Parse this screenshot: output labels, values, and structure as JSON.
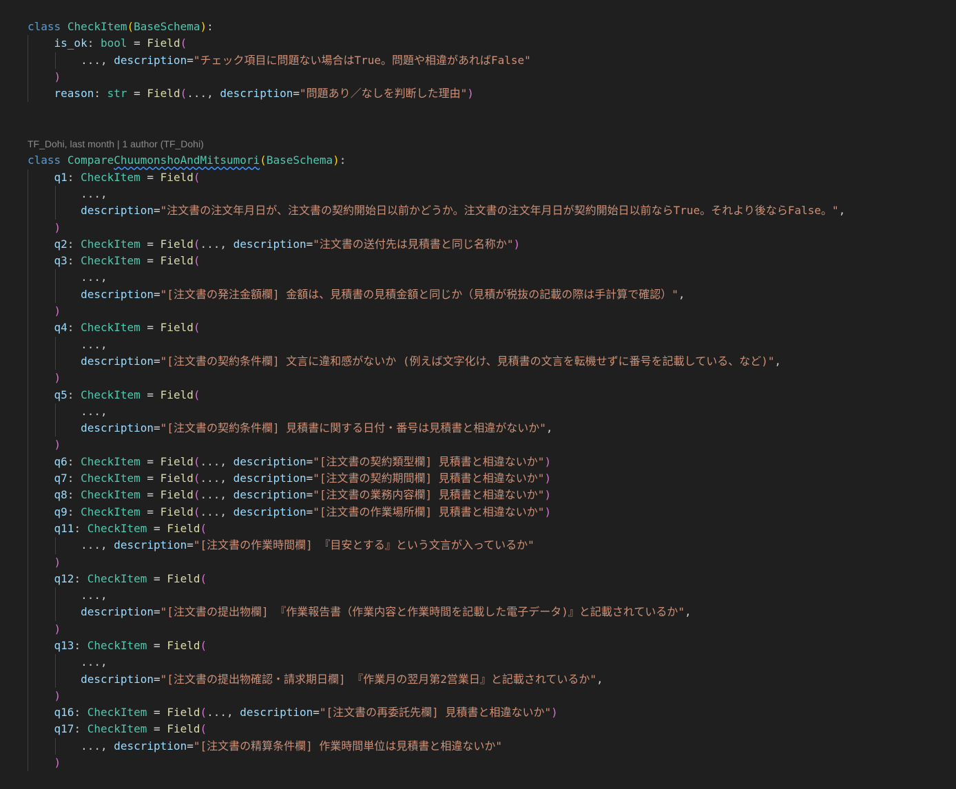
{
  "editor": {
    "blame_annotation": "TF_Dohi, last month | 1 author (TF_Dohi)",
    "lines": [
      {
        "indent": 0,
        "tokens": [
          [
            "kw",
            "class"
          ],
          [
            "t",
            " "
          ],
          [
            "cls",
            "CheckItem"
          ],
          [
            "p1",
            "("
          ],
          [
            "cls",
            "BaseSchema"
          ],
          [
            "p1",
            ")"
          ],
          [
            "t",
            ":"
          ]
        ]
      },
      {
        "indent": 1,
        "tokens": [
          [
            "var",
            "is_ok"
          ],
          [
            "t",
            ": "
          ],
          [
            "cls",
            "bool"
          ],
          [
            "op",
            " = "
          ],
          [
            "fn",
            "Field"
          ],
          [
            "p2",
            "("
          ]
        ]
      },
      {
        "indent": 2,
        "tokens": [
          [
            "t",
            "..., "
          ],
          [
            "var",
            "description"
          ],
          [
            "op",
            "="
          ],
          [
            "str",
            "\"チェック項目に問題ない場合はTrue。問題や相違があればFalse\""
          ]
        ]
      },
      {
        "indent": 1,
        "tokens": [
          [
            "p2",
            ")"
          ]
        ]
      },
      {
        "indent": 1,
        "tokens": [
          [
            "var",
            "reason"
          ],
          [
            "t",
            ": "
          ],
          [
            "cls",
            "str"
          ],
          [
            "op",
            " = "
          ],
          [
            "fn",
            "Field"
          ],
          [
            "p2",
            "("
          ],
          [
            "t",
            "..., "
          ],
          [
            "var",
            "description"
          ],
          [
            "op",
            "="
          ],
          [
            "str",
            "\"問題あり／なしを判断した理由\""
          ],
          [
            "p2",
            ")"
          ]
        ]
      },
      {
        "indent": 0,
        "tokens": []
      },
      {
        "indent": 0,
        "tokens": []
      },
      {
        "indent": 0,
        "blame": true,
        "tokens": []
      },
      {
        "indent": 0,
        "tokens": [
          [
            "kw",
            "class"
          ],
          [
            "t",
            " "
          ],
          [
            "cls",
            "Compare"
          ],
          [
            "clsq",
            "ChuumonshoAndMitsumori"
          ],
          [
            "p1",
            "("
          ],
          [
            "cls",
            "BaseSchema"
          ],
          [
            "p1",
            ")"
          ],
          [
            "t",
            ":"
          ]
        ]
      },
      {
        "indent": 1,
        "tokens": [
          [
            "var",
            "q1"
          ],
          [
            "t",
            ": "
          ],
          [
            "cls",
            "CheckItem"
          ],
          [
            "op",
            " = "
          ],
          [
            "fn",
            "Field"
          ],
          [
            "p2",
            "("
          ]
        ]
      },
      {
        "indent": 2,
        "tokens": [
          [
            "t",
            "...,"
          ]
        ]
      },
      {
        "indent": 2,
        "tokens": [
          [
            "var",
            "description"
          ],
          [
            "op",
            "="
          ],
          [
            "str",
            "\"注文書の注文年月日が、注文書の契約開始日以前かどうか。注文書の注文年月日が契約開始日以前ならTrue。それより後ならFalse。\""
          ],
          [
            "t",
            ","
          ]
        ]
      },
      {
        "indent": 1,
        "tokens": [
          [
            "p2",
            ")"
          ]
        ]
      },
      {
        "indent": 1,
        "tokens": [
          [
            "var",
            "q2"
          ],
          [
            "t",
            ": "
          ],
          [
            "cls",
            "CheckItem"
          ],
          [
            "op",
            " = "
          ],
          [
            "fn",
            "Field"
          ],
          [
            "p2",
            "("
          ],
          [
            "t",
            "..., "
          ],
          [
            "var",
            "description"
          ],
          [
            "op",
            "="
          ],
          [
            "str",
            "\"注文書の送付先は見積書と同じ名称か\""
          ],
          [
            "p2",
            ")"
          ]
        ]
      },
      {
        "indent": 1,
        "tokens": [
          [
            "var",
            "q3"
          ],
          [
            "t",
            ": "
          ],
          [
            "cls",
            "CheckItem"
          ],
          [
            "op",
            " = "
          ],
          [
            "fn",
            "Field"
          ],
          [
            "p2",
            "("
          ]
        ]
      },
      {
        "indent": 2,
        "tokens": [
          [
            "t",
            "...,"
          ]
        ]
      },
      {
        "indent": 2,
        "tokens": [
          [
            "var",
            "description"
          ],
          [
            "op",
            "="
          ],
          [
            "str",
            "\"[注文書の発注金額欄] 金額は、見積書の見積金額と同じか（見積が税抜の記載の際は手計算で確認）\""
          ],
          [
            "t",
            ","
          ]
        ]
      },
      {
        "indent": 1,
        "tokens": [
          [
            "p2",
            ")"
          ]
        ]
      },
      {
        "indent": 1,
        "tokens": [
          [
            "var",
            "q4"
          ],
          [
            "t",
            ": "
          ],
          [
            "cls",
            "CheckItem"
          ],
          [
            "op",
            " = "
          ],
          [
            "fn",
            "Field"
          ],
          [
            "p2",
            "("
          ]
        ]
      },
      {
        "indent": 2,
        "tokens": [
          [
            "t",
            "...,"
          ]
        ]
      },
      {
        "indent": 2,
        "tokens": [
          [
            "var",
            "description"
          ],
          [
            "op",
            "="
          ],
          [
            "str",
            "\"[注文書の契約条件欄] 文言に違和感がないか (例えば文字化け、見積書の文言を転機せずに番号を記載している、など)\""
          ],
          [
            "t",
            ","
          ]
        ]
      },
      {
        "indent": 1,
        "tokens": [
          [
            "p2",
            ")"
          ]
        ]
      },
      {
        "indent": 1,
        "tokens": [
          [
            "var",
            "q5"
          ],
          [
            "t",
            ": "
          ],
          [
            "cls",
            "CheckItem"
          ],
          [
            "op",
            " = "
          ],
          [
            "fn",
            "Field"
          ],
          [
            "p2",
            "("
          ]
        ]
      },
      {
        "indent": 2,
        "tokens": [
          [
            "t",
            "...,"
          ]
        ]
      },
      {
        "indent": 2,
        "tokens": [
          [
            "var",
            "description"
          ],
          [
            "op",
            "="
          ],
          [
            "str",
            "\"[注文書の契約条件欄] 見積書に関する日付・番号は見積書と相違がないか\""
          ],
          [
            "t",
            ","
          ]
        ]
      },
      {
        "indent": 1,
        "tokens": [
          [
            "p2",
            ")"
          ]
        ]
      },
      {
        "indent": 1,
        "tokens": [
          [
            "var",
            "q6"
          ],
          [
            "t",
            ": "
          ],
          [
            "cls",
            "CheckItem"
          ],
          [
            "op",
            " = "
          ],
          [
            "fn",
            "Field"
          ],
          [
            "p2",
            "("
          ],
          [
            "t",
            "..., "
          ],
          [
            "var",
            "description"
          ],
          [
            "op",
            "="
          ],
          [
            "str",
            "\"[注文書の契約類型欄] 見積書と相違ないか\""
          ],
          [
            "p2",
            ")"
          ]
        ]
      },
      {
        "indent": 1,
        "tokens": [
          [
            "var",
            "q7"
          ],
          [
            "t",
            ": "
          ],
          [
            "cls",
            "CheckItem"
          ],
          [
            "op",
            " = "
          ],
          [
            "fn",
            "Field"
          ],
          [
            "p2",
            "("
          ],
          [
            "t",
            "..., "
          ],
          [
            "var",
            "description"
          ],
          [
            "op",
            "="
          ],
          [
            "str",
            "\"[注文書の契約期間欄] 見積書と相違ないか\""
          ],
          [
            "p2",
            ")"
          ]
        ]
      },
      {
        "indent": 1,
        "tokens": [
          [
            "var",
            "q8"
          ],
          [
            "t",
            ": "
          ],
          [
            "cls",
            "CheckItem"
          ],
          [
            "op",
            " = "
          ],
          [
            "fn",
            "Field"
          ],
          [
            "p2",
            "("
          ],
          [
            "t",
            "..., "
          ],
          [
            "var",
            "description"
          ],
          [
            "op",
            "="
          ],
          [
            "str",
            "\"[注文書の業務内容欄] 見積書と相違ないか\""
          ],
          [
            "p2",
            ")"
          ]
        ]
      },
      {
        "indent": 1,
        "tokens": [
          [
            "var",
            "q9"
          ],
          [
            "t",
            ": "
          ],
          [
            "cls",
            "CheckItem"
          ],
          [
            "op",
            " = "
          ],
          [
            "fn",
            "Field"
          ],
          [
            "p2",
            "("
          ],
          [
            "t",
            "..., "
          ],
          [
            "var",
            "description"
          ],
          [
            "op",
            "="
          ],
          [
            "str",
            "\"[注文書の作業場所欄] 見積書と相違ないか\""
          ],
          [
            "p2",
            ")"
          ]
        ]
      },
      {
        "indent": 1,
        "tokens": [
          [
            "var",
            "q11"
          ],
          [
            "t",
            ": "
          ],
          [
            "cls",
            "CheckItem"
          ],
          [
            "op",
            " = "
          ],
          [
            "fn",
            "Field"
          ],
          [
            "p2",
            "("
          ]
        ]
      },
      {
        "indent": 2,
        "tokens": [
          [
            "t",
            "..., "
          ],
          [
            "var",
            "description"
          ],
          [
            "op",
            "="
          ],
          [
            "str",
            "\"[注文書の作業時間欄] 『目安とする』という文言が入っているか\""
          ]
        ]
      },
      {
        "indent": 1,
        "tokens": [
          [
            "p2",
            ")"
          ]
        ]
      },
      {
        "indent": 1,
        "tokens": [
          [
            "var",
            "q12"
          ],
          [
            "t",
            ": "
          ],
          [
            "cls",
            "CheckItem"
          ],
          [
            "op",
            " = "
          ],
          [
            "fn",
            "Field"
          ],
          [
            "p2",
            "("
          ]
        ]
      },
      {
        "indent": 2,
        "tokens": [
          [
            "t",
            "...,"
          ]
        ]
      },
      {
        "indent": 2,
        "tokens": [
          [
            "var",
            "description"
          ],
          [
            "op",
            "="
          ],
          [
            "str",
            "\"[注文書の提出物欄] 『作業報告書（作業内容と作業時間を記載した電子データ)』と記載されているか\""
          ],
          [
            "t",
            ","
          ]
        ]
      },
      {
        "indent": 1,
        "tokens": [
          [
            "p2",
            ")"
          ]
        ]
      },
      {
        "indent": 1,
        "tokens": [
          [
            "var",
            "q13"
          ],
          [
            "t",
            ": "
          ],
          [
            "cls",
            "CheckItem"
          ],
          [
            "op",
            " = "
          ],
          [
            "fn",
            "Field"
          ],
          [
            "p2",
            "("
          ]
        ]
      },
      {
        "indent": 2,
        "tokens": [
          [
            "t",
            "...,"
          ]
        ]
      },
      {
        "indent": 2,
        "tokens": [
          [
            "var",
            "description"
          ],
          [
            "op",
            "="
          ],
          [
            "str",
            "\"[注文書の提出物確認・請求期日欄] 『作業月の翌月第2営業日』と記載されているか\""
          ],
          [
            "t",
            ","
          ]
        ]
      },
      {
        "indent": 1,
        "tokens": [
          [
            "p2",
            ")"
          ]
        ]
      },
      {
        "indent": 1,
        "tokens": [
          [
            "var",
            "q16"
          ],
          [
            "t",
            ": "
          ],
          [
            "cls",
            "CheckItem"
          ],
          [
            "op",
            " = "
          ],
          [
            "fn",
            "Field"
          ],
          [
            "p2",
            "("
          ],
          [
            "t",
            "..., "
          ],
          [
            "var",
            "description"
          ],
          [
            "op",
            "="
          ],
          [
            "str",
            "\"[注文書の再委託先欄] 見積書と相違ないか\""
          ],
          [
            "p2",
            ")"
          ]
        ]
      },
      {
        "indent": 1,
        "tokens": [
          [
            "var",
            "q17"
          ],
          [
            "t",
            ": "
          ],
          [
            "cls",
            "CheckItem"
          ],
          [
            "op",
            " = "
          ],
          [
            "fn",
            "Field"
          ],
          [
            "p2",
            "("
          ]
        ]
      },
      {
        "indent": 2,
        "tokens": [
          [
            "t",
            "..., "
          ],
          [
            "var",
            "description"
          ],
          [
            "op",
            "="
          ],
          [
            "str",
            "\"[注文書の精算条件欄] 作業時間単位は見積書と相違ないか\""
          ]
        ]
      },
      {
        "indent": 1,
        "tokens": [
          [
            "p2",
            ")"
          ]
        ]
      }
    ]
  },
  "colors": {
    "background": "#1f1f1f",
    "keyword": "#569cd6",
    "class_name": "#4ec9b0",
    "variable": "#9cdcfe",
    "function": "#dcdcaa",
    "string": "#ce9178",
    "bracket_level1": "#ffd700",
    "bracket_level2": "#da70d6",
    "blame_text": "#8b8b8b",
    "indent_guide": "#404040",
    "squiggle": "#3794ff"
  }
}
